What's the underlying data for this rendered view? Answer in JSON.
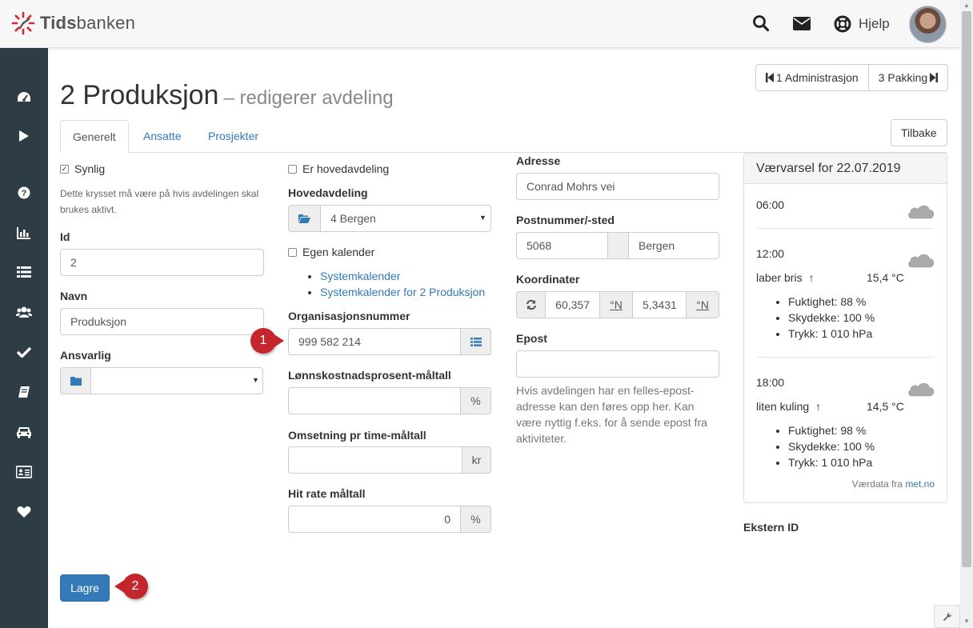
{
  "app": {
    "logo_text_bold": "Tids",
    "logo_text_light": "banken",
    "help_label": "Hjelp"
  },
  "header": {
    "title": "2 Produksjon",
    "subtitle": "– redigerer avdeling",
    "prev_label": "1 Administrasjon",
    "next_label": "3 Pakking",
    "back_label": "Tilbake"
  },
  "tabs": [
    {
      "label": "Generelt",
      "active": true
    },
    {
      "label": "Ansatte",
      "active": false
    },
    {
      "label": "Prosjekter",
      "active": false
    }
  ],
  "form": {
    "visible_label": "Synlig",
    "visible_checked": true,
    "visible_help": "Dette krysset må være på hvis avdelingen skal brukes aktivt.",
    "id_label": "Id",
    "id_value": "2",
    "name_label": "Navn",
    "name_value": "Produksjon",
    "responsible_label": "Ansvarlig",
    "responsible_value": "",
    "is_main_label": "Er hovedavdeling",
    "is_main_checked": false,
    "main_dept_label": "Hovedavdeling",
    "main_dept_value": "4 Bergen",
    "own_calendar_label": "Egen kalender",
    "own_calendar_checked": false,
    "calendar_links": [
      "Systemkalender",
      "Systemkalender for 2 Produksjon"
    ],
    "org_no_label": "Organisasjonsnummer",
    "org_no_value": "999 582 214",
    "wage_label": "Lønnskostnadsprosent-måltall",
    "wage_value": "",
    "wage_unit": "%",
    "revenue_label": "Omsetning pr time-måltall",
    "revenue_value": "",
    "revenue_unit": "kr",
    "hit_rate_label": "Hit rate måltall",
    "hit_rate_value": "0",
    "hit_rate_unit": "%",
    "address_label": "Adresse",
    "address_value": "Conrad Mohrs vei",
    "postal_label": "Postnummer/-sted",
    "postal_code": "5068",
    "postal_city": "Bergen",
    "coords_label": "Koordinater",
    "lat_value": "60,357",
    "lat_unit": "°N",
    "lon_value": "5,3431",
    "lon_unit": "°N",
    "email_label": "Epost",
    "email_value": "",
    "email_help": "Hvis avdelingen har en felles-epost-adresse kan den føres opp her. Kan være nyttig f.eks. for å sende epost fra aktiviteter.",
    "external_id_label": "Ekstern ID",
    "save_label": "Lagre"
  },
  "weather": {
    "title": "Værvarsel for 22.07.2019",
    "entries": [
      {
        "time": "06:00",
        "wind": "",
        "temp": "",
        "details": []
      },
      {
        "time": "12:00",
        "wind": "laber bris",
        "temp": "15,4 °C",
        "details": [
          "Fuktighet: 88 %",
          "Skydekke: 100 %",
          "Trykk: 1 010 hPa"
        ]
      },
      {
        "time": "18:00",
        "wind": "liten kuling",
        "temp": "14,5 °C",
        "details": [
          "Fuktighet: 98 %",
          "Skydekke: 100 %",
          "Trykk: 1 010 hPa"
        ]
      }
    ],
    "credit_prefix": "Værdata fra",
    "credit_link": "met.no"
  },
  "callouts": [
    "1",
    "2"
  ],
  "colors": {
    "sidebar": "#2e3c45",
    "primary": "#337ab7",
    "callout": "#c4262e",
    "logo_accent": "#d9262e"
  },
  "icons": {
    "sidebar": [
      "dashboard-icon",
      "play-icon",
      "question-icon",
      "bar-chart-icon",
      "list-icon",
      "users-icon",
      "check-icon",
      "book-icon",
      "car-icon",
      "id-card-icon",
      "heart-icon"
    ],
    "topbar": [
      "search-icon",
      "envelope-icon",
      "lifebuoy-icon"
    ]
  }
}
